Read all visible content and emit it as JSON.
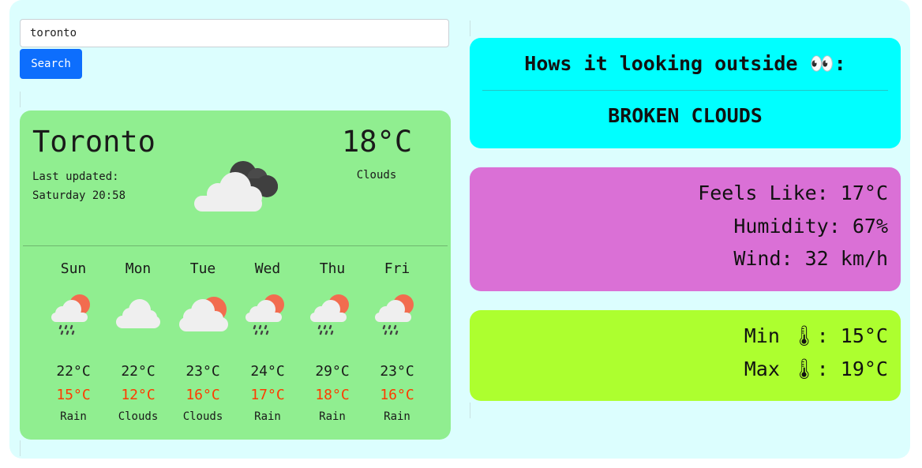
{
  "search": {
    "value": "toronto",
    "button_label": "Search"
  },
  "current": {
    "city": "Toronto",
    "updated_label": "Last updated:",
    "updated_time": "Saturday 20:58",
    "temperature": "18°C",
    "condition": "Clouds",
    "icon": "broken-clouds-icon"
  },
  "forecast": [
    {
      "day": "Sun",
      "max": "22°C",
      "min": "15°C",
      "desc": "Rain",
      "icon": "rain-sun-icon"
    },
    {
      "day": "Mon",
      "max": "22°C",
      "min": "12°C",
      "desc": "Clouds",
      "icon": "cloud-icon"
    },
    {
      "day": "Tue",
      "max": "23°C",
      "min": "16°C",
      "desc": "Clouds",
      "icon": "cloud-sun-icon"
    },
    {
      "day": "Wed",
      "max": "24°C",
      "min": "17°C",
      "desc": "Rain",
      "icon": "rain-sun-icon"
    },
    {
      "day": "Thu",
      "max": "29°C",
      "min": "18°C",
      "desc": "Rain",
      "icon": "rain-sun-icon"
    },
    {
      "day": "Fri",
      "max": "23°C",
      "min": "16°C",
      "desc": "Rain",
      "icon": "rain-sun-icon"
    }
  ],
  "outside": {
    "title": "Hows it looking outside 👀:",
    "description": "BROKEN CLOUDS"
  },
  "details": {
    "feels_like": "Feels Like: 17°C",
    "humidity": "Humidity: 67%",
    "wind": "Wind: 32 km/h"
  },
  "minmax": {
    "min": "Min 🌡: 15°C",
    "max": "Max 🌡: 19°C"
  },
  "colors": {
    "page_bg": "#dcfefe",
    "button": "#0d6efd",
    "main_card": "#90ee90",
    "outside_card": "#00ffff",
    "details_card": "#da70d6",
    "minmax_card": "#adff2f",
    "min_temp": "#ff3b00"
  }
}
